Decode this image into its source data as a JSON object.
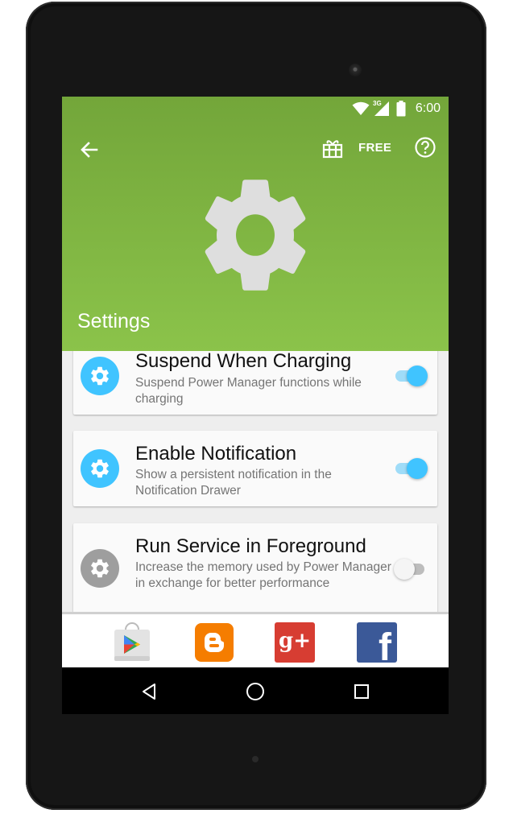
{
  "status_bar": {
    "time": "6:00",
    "network_label": "3G",
    "icons": [
      "wifi-icon",
      "cell-signal-icon",
      "battery-icon"
    ]
  },
  "toolbar": {
    "back_icon": "arrow-left-icon",
    "gift_icon": "gift-icon",
    "free_label": "FREE",
    "help_icon": "help-circle-icon"
  },
  "header": {
    "hero_icon": "gear-icon",
    "title": "Settings",
    "colors": {
      "top": "#73a63a",
      "bottom": "#8bc34a"
    }
  },
  "settings": [
    {
      "title": "Suspend When Charging",
      "subtitle": "Suspend Power Manager functions while charging",
      "icon": "gear-icon",
      "enabled": true
    },
    {
      "title": "Enable Notification",
      "subtitle": "Show a persistent notification in the Notification Drawer",
      "icon": "gear-icon",
      "enabled": true
    },
    {
      "title": "Run Service in Foreground",
      "subtitle": "Increase the memory used by Power Manager in exchange for better performance",
      "icon": "gear-icon",
      "enabled": false
    }
  ],
  "share_bar": {
    "items": [
      "google-play-icon",
      "blogger-icon",
      "google-plus-icon",
      "facebook-icon"
    ],
    "google_plus_label": "g+",
    "facebook_label": "f"
  },
  "nav_bar": {
    "items": [
      "back-triangle-icon",
      "home-circle-icon",
      "recents-square-icon"
    ]
  },
  "colors": {
    "accent": "#40c4ff",
    "accent_track": "#9fdcf8",
    "disabled": "#9e9e9e"
  }
}
